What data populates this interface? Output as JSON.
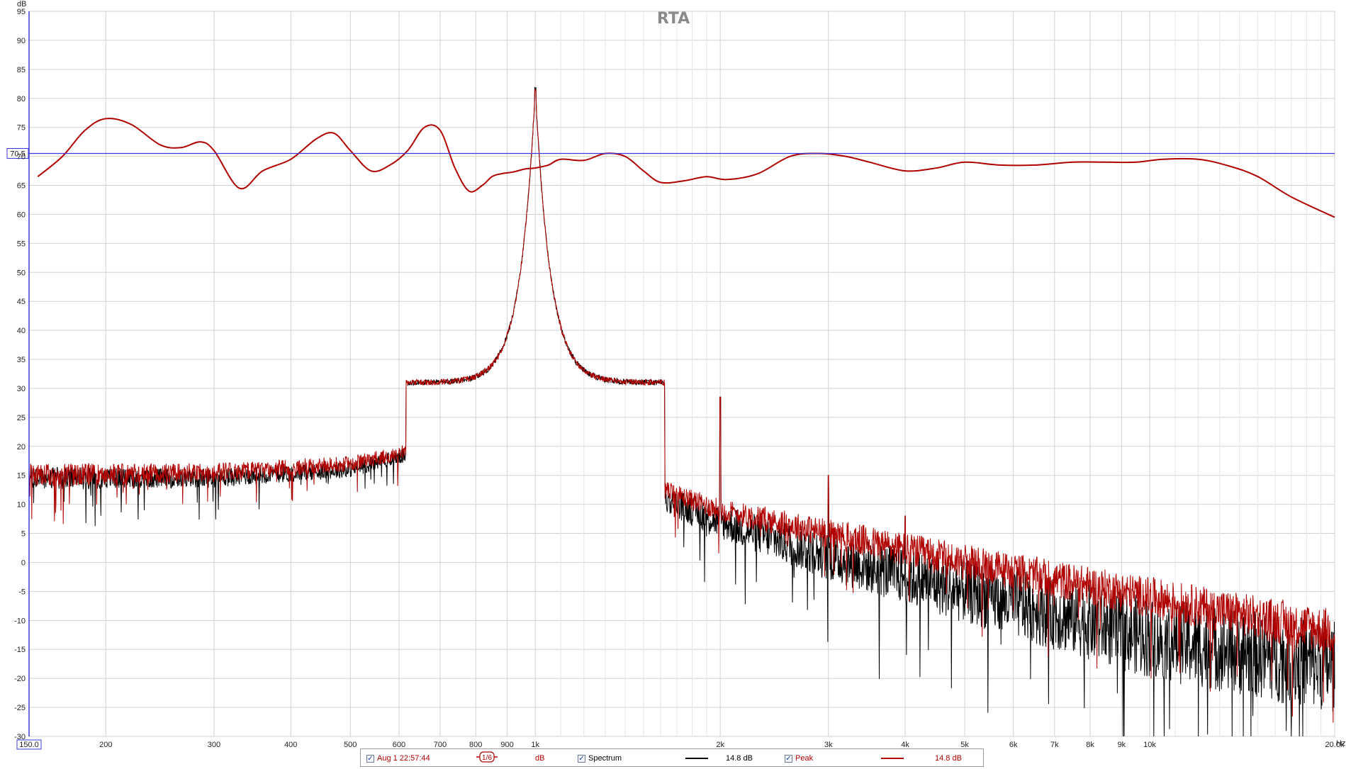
{
  "chart_data": {
    "type": "line",
    "title": "RTA",
    "ylabel": "dB",
    "xunit": "Hz",
    "xscale": "log",
    "xlim": [
      150,
      20000
    ],
    "ylim": [
      -30,
      95
    ],
    "grid": true,
    "yticks": [
      95,
      90,
      85,
      80,
      75,
      70,
      65,
      60,
      55,
      50,
      45,
      40,
      35,
      30,
      25,
      20,
      15,
      10,
      5,
      0,
      -5,
      -10,
      -15,
      -20,
      -25,
      -30
    ],
    "xticks": [
      {
        "v": 150,
        "label": "150.0"
      },
      {
        "v": 200,
        "label": "200"
      },
      {
        "v": 300,
        "label": "300"
      },
      {
        "v": 400,
        "label": "400"
      },
      {
        "v": 500,
        "label": "500"
      },
      {
        "v": 600,
        "label": "600"
      },
      {
        "v": 700,
        "label": "700"
      },
      {
        "v": 800,
        "label": "800"
      },
      {
        "v": 900,
        "label": "900"
      },
      {
        "v": 1000,
        "label": "1k"
      },
      {
        "v": 2000,
        "label": "2k"
      },
      {
        "v": 3000,
        "label": "3k"
      },
      {
        "v": 4000,
        "label": "4k"
      },
      {
        "v": 5000,
        "label": "5k"
      },
      {
        "v": 6000,
        "label": "6k"
      },
      {
        "v": 7000,
        "label": "7k"
      },
      {
        "v": 8000,
        "label": "8k"
      },
      {
        "v": 9000,
        "label": "9k"
      },
      {
        "v": 10000,
        "label": "10k"
      },
      {
        "v": 20000,
        "label": "20.0k"
      }
    ],
    "minor_x": [
      1100,
      1200,
      1300,
      1400,
      1500,
      1600,
      1700,
      1800,
      1900,
      11000,
      12000,
      13000,
      14000,
      15000,
      16000,
      17000,
      18000,
      19000
    ],
    "reference_line": {
      "y": 70.5,
      "label": "70.5",
      "color": "#3a3ae0"
    },
    "series": [
      {
        "name": "Aug 1 22:57:44",
        "color": "#b00000",
        "style": "smooth",
        "x": [
          155,
          170,
          185,
          200,
          220,
          245,
          265,
          285,
          300,
          330,
          360,
          400,
          440,
          470,
          500,
          540,
          580,
          620,
          660,
          700,
          740,
          780,
          820,
          850,
          880,
          920,
          960,
          1000,
          1050,
          1100,
          1200,
          1300,
          1400,
          1500,
          1600,
          1750,
          1900,
          2050,
          2300,
          2600,
          2900,
          3200,
          3500,
          4000,
          4500,
          5000,
          5700,
          6500,
          7500,
          8500,
          9500,
          10500,
          12000,
          13500,
          15000,
          17000,
          20000
        ],
        "y": [
          66.5,
          70,
          74.5,
          76.5,
          75.5,
          72,
          71.5,
          72.5,
          71,
          64.5,
          67.5,
          69.5,
          73,
          74,
          71,
          67.5,
          68.5,
          71,
          75,
          74.5,
          68,
          64,
          65,
          66.5,
          67,
          67.3,
          67.8,
          68.0,
          68.5,
          69.5,
          69.3,
          70.5,
          70,
          67.5,
          65.5,
          65.8,
          66.5,
          66.0,
          67,
          70,
          70.5,
          70,
          69,
          67.5,
          68,
          69,
          68.5,
          68.5,
          69,
          69,
          69,
          69.5,
          69.5,
          68.3,
          66.5,
          63,
          59.5
        ]
      },
      {
        "name": "Spectrum",
        "legend_value": "14.8 dB",
        "color": "#000000",
        "style": "noise",
        "fundamental": {
          "f": 1000,
          "db": 81.5
        },
        "floor": [
          [
            150,
            14.5
          ],
          [
            300,
            14.5
          ],
          [
            500,
            16
          ],
          [
            700,
            20
          ],
          [
            900,
            30
          ],
          [
            1300,
            15
          ],
          [
            2000,
            7
          ],
          [
            3000,
            1
          ],
          [
            5000,
            -5
          ],
          [
            10000,
            -13
          ],
          [
            20000,
            -18
          ]
        ],
        "spread": [
          [
            150,
            2
          ],
          [
            1000,
            1
          ],
          [
            1500,
            2
          ],
          [
            2000,
            3
          ],
          [
            4000,
            5
          ],
          [
            10000,
            7
          ],
          [
            20000,
            8
          ]
        ],
        "harmonics": [
          {
            "f": 2000,
            "db": 28.5
          },
          {
            "f": 3000,
            "db": 15
          },
          {
            "f": 4000,
            "db": 8
          }
        ]
      },
      {
        "name": "Peak",
        "legend_value": "14.8 dB",
        "color": "#b00000",
        "style": "noise",
        "fundamental": {
          "f": 1000,
          "db": 81.5
        },
        "floor": [
          [
            150,
            15
          ],
          [
            300,
            15.5
          ],
          [
            500,
            17
          ],
          [
            700,
            20.5
          ],
          [
            900,
            30
          ],
          [
            1300,
            16
          ],
          [
            2000,
            9
          ],
          [
            3000,
            5
          ],
          [
            5000,
            0
          ],
          [
            10000,
            -6
          ],
          [
            20000,
            -12
          ]
        ],
        "spread": [
          [
            150,
            2
          ],
          [
            1000,
            1
          ],
          [
            1500,
            1.5
          ],
          [
            2000,
            2
          ],
          [
            4000,
            3
          ],
          [
            10000,
            3.5
          ],
          [
            20000,
            4
          ]
        ],
        "harmonics": [
          {
            "f": 2000,
            "db": 28.5
          },
          {
            "f": 3000,
            "db": 15
          },
          {
            "f": 4000,
            "db": 8
          }
        ]
      }
    ]
  },
  "legend": {
    "measurement_label": "Aug 1 22:57:44",
    "smoothing": "1/6",
    "unit": "dB",
    "spectrum_label": "Spectrum",
    "spectrum_value": "14.8 dB",
    "peak_label": "Peak",
    "peak_value": "14.8 dB",
    "check": "✓"
  }
}
